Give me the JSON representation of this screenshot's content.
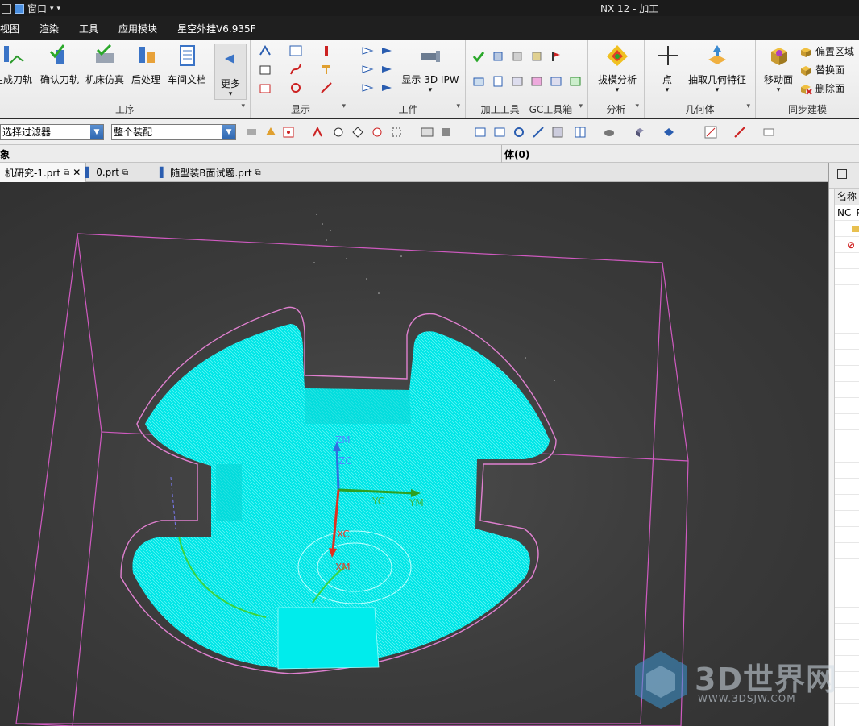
{
  "window": {
    "menu_label": "窗口",
    "app_title": "NX 12 - 加工"
  },
  "menubar": {
    "items": [
      "视图",
      "渲染",
      "工具",
      "应用模块",
      "星空外挂V6.935F"
    ]
  },
  "ribbon": {
    "operations_group": {
      "label": "工序",
      "buttons": [
        "生成刀轨",
        "确认刀轨",
        "机床仿真",
        "后处理",
        "车间文档",
        "更多"
      ]
    },
    "display_group": {
      "label": "显示"
    },
    "workpiece_group": {
      "label": "工件",
      "ipw_label": "显示 3D IPW"
    },
    "gc_group": {
      "label": "加工工具 - GC工具箱"
    },
    "analysis_group": {
      "label": "分析",
      "button": "拔模分析"
    },
    "geometry_group": {
      "label": "几何体",
      "buttons": [
        "点",
        "抽取几何特征"
      ]
    },
    "sync_group": {
      "label": "同步建模",
      "move_face": "移动面",
      "items": [
        "偏置区域",
        "替换面",
        "删除面"
      ]
    }
  },
  "toolbar": {
    "filter_combo": "选择过滤器",
    "scope_combo": "整个装配"
  },
  "selection_bar": {
    "left_label": "象",
    "body_label": "体(0)"
  },
  "tabs": [
    {
      "label": "机研究-1.prt",
      "active": true
    },
    {
      "label": "0.prt",
      "active": false
    },
    {
      "label": "随型装B面试题.prt",
      "active": false
    }
  ],
  "navigator": {
    "header_col": "名称",
    "root": "NC_P"
  },
  "viewport": {
    "axis_labels": {
      "zm": "ZM",
      "zc": "ZC",
      "yc": "YC",
      "ym": "YM",
      "xc": "XC",
      "xm": "XM"
    },
    "colors": {
      "part": "#00e8e8",
      "wireframe": "#d05ac0",
      "axis_z": "#2f6fe0",
      "axis_y": "#2fa020",
      "axis_x": "#e03020"
    }
  },
  "watermark": {
    "text": "3D世界网",
    "url": "WWW.3DSJW.COM"
  }
}
